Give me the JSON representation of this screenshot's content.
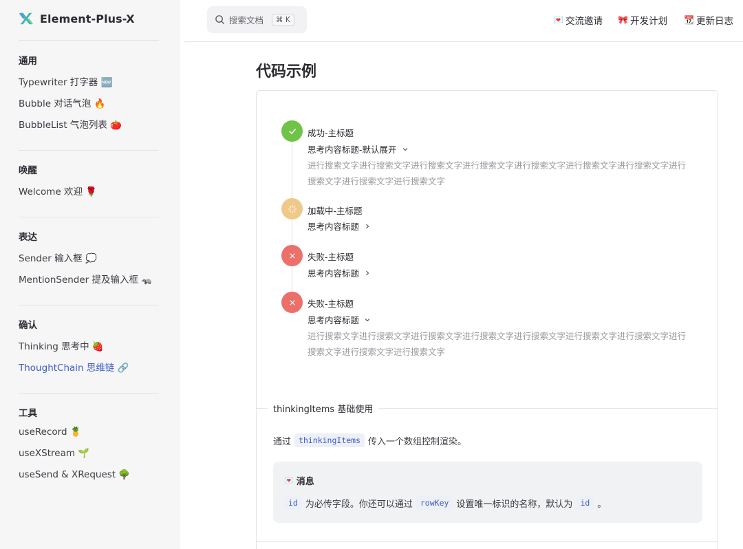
{
  "brand": {
    "name": "Element-Plus-X"
  },
  "sidebar": {
    "groups": [
      {
        "title": "通用",
        "items": [
          {
            "label": "Typewriter 打字器 🆕"
          },
          {
            "label": "Bubble 对话气泡 🔥"
          },
          {
            "label": "BubbleList 气泡列表 🍅"
          }
        ]
      },
      {
        "title": "唤醒",
        "items": [
          {
            "label": "Welcome 欢迎 🌹"
          }
        ]
      },
      {
        "title": "表达",
        "items": [
          {
            "label": "Sender 输入框 💭"
          },
          {
            "label": "MentionSender 提及输入框 🦡"
          }
        ]
      },
      {
        "title": "确认",
        "items": [
          {
            "label": "Thinking 思考中 🍓"
          },
          {
            "label": "ThoughtChain 思维链 🔗"
          }
        ]
      },
      {
        "title": "工具",
        "items": [
          {
            "label": "useRecord 🍍"
          },
          {
            "label": "useXStream 🌱"
          },
          {
            "label": "useSend & XRequest 🌳"
          }
        ]
      }
    ],
    "active": "ThoughtChain 思维链 🔗"
  },
  "search": {
    "placeholder": "搜索文档",
    "shortcut": "⌘ K"
  },
  "topnav": [
    {
      "emoji": "💌",
      "label": "交流邀请"
    },
    {
      "emoji": "🎀",
      "label": "开发计划"
    },
    {
      "emoji": "📆",
      "label": "更新日志"
    }
  ],
  "page": {
    "title": "代码示例"
  },
  "chain": [
    {
      "status": "success",
      "title": "成功-主标题",
      "subtitle": "思考内容标题-默认展开",
      "expanded": true,
      "body": "进行搜索文字进行搜索文字进行搜索文字进行搜索文字进行搜索文字进行搜索文字进行搜索文字进行搜索文字进行搜索文字进行搜索文字"
    },
    {
      "status": "loading",
      "title": "加载中-主标题",
      "subtitle": "思考内容标题",
      "expanded": false,
      "body": ""
    },
    {
      "status": "error",
      "title": "失败-主标题",
      "subtitle": "思考内容标题",
      "expanded": false,
      "body": ""
    },
    {
      "status": "error",
      "title": "失败-主标题",
      "subtitle": "思考内容标题",
      "expanded": true,
      "body": "进行搜索文字进行搜索文字进行搜索文字进行搜索文字进行搜索文字进行搜索文字进行搜索文字进行搜索文字进行搜索文字进行搜索文字"
    }
  ],
  "section": {
    "label": "thinkingItems 基础使用",
    "desc_pre": "通过",
    "desc_code": "thinkingItems",
    "desc_post": "传入一个数组控制渲染。"
  },
  "tip": {
    "emoji": "💌",
    "title": "消息",
    "code1": "id",
    "text1": "为必传字段。你还可以通过",
    "code2": "rowKey",
    "text2": "设置唯一标识的名称，默认为",
    "code3": "id",
    "text3": "。"
  },
  "colors": {
    "accent": "#3a5ccc",
    "success": "#6fc346",
    "loading": "#efc98a",
    "error": "#ec6f6a"
  }
}
